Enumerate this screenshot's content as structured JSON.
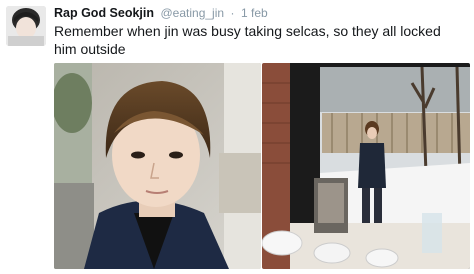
{
  "tweet": {
    "display_name": "Rap God Seokjin",
    "handle": "@eating_jin",
    "separator": "·",
    "date": "1 feb",
    "text": "Remember when jin was busy taking selcas, so they all locked him outside"
  },
  "media": {
    "photos": [
      {
        "name": "selca-photo"
      },
      {
        "name": "outside-window-photo"
      }
    ]
  },
  "colors": {
    "name": "#14171a",
    "meta": "#8899a6",
    "background": "#ffffff"
  },
  "icons": {
    "avatar": "profile-avatar"
  }
}
